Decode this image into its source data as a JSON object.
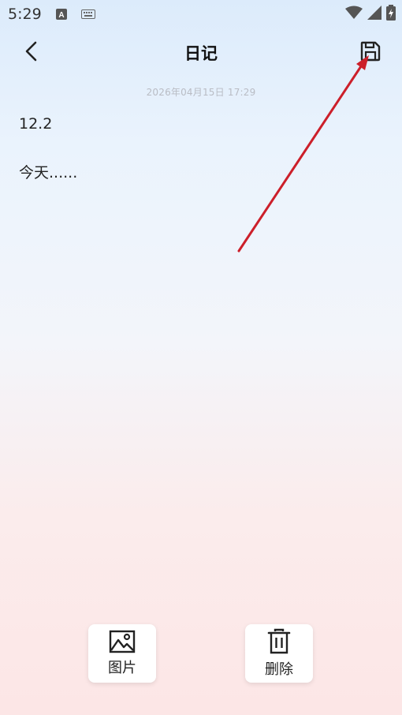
{
  "status_bar": {
    "time": "5:29",
    "icons": [
      "a-badge-icon",
      "keyboard-icon",
      "wifi-icon",
      "signal-icon",
      "battery-icon"
    ]
  },
  "header": {
    "title": "日记",
    "back_icon": "chevron-left-icon",
    "save_icon": "save-icon"
  },
  "entry": {
    "datetime": "2026年04月15日  17:29",
    "line1": "12.2",
    "line2": "今天......"
  },
  "toolbar": {
    "picture_label": "图片",
    "picture_icon": "image-icon",
    "delete_label": "删除",
    "delete_icon": "trash-icon"
  },
  "annotation": {
    "arrow_color": "#cc1f2a"
  }
}
